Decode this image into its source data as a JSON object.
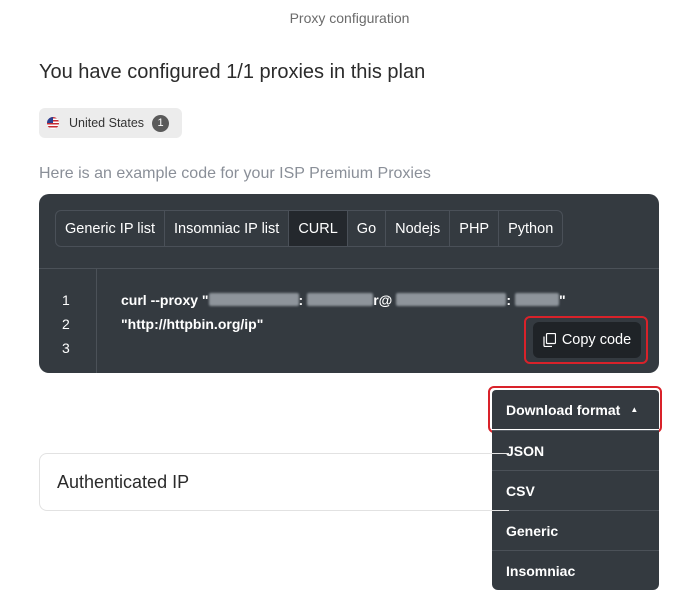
{
  "header": {
    "title": "Proxy configuration"
  },
  "plan": {
    "title": "You have configured 1/1 proxies in this plan",
    "country": {
      "label": "United States",
      "count": "1",
      "flag_icon": "us-flag-icon"
    }
  },
  "example": {
    "title": "Here is an example code for your ISP Premium Proxies",
    "tabs": [
      {
        "label": "Generic IP list",
        "active": false
      },
      {
        "label": "Insomniac IP list",
        "active": false
      },
      {
        "label": "CURL",
        "active": true
      },
      {
        "label": "Go",
        "active": false
      },
      {
        "label": "Nodejs",
        "active": false
      },
      {
        "label": "PHP",
        "active": false
      },
      {
        "label": "Python",
        "active": false
      }
    ],
    "line_numbers": [
      "1",
      "2",
      "3"
    ],
    "code": {
      "prefix": "curl --proxy \"",
      "sep1": ":",
      "at": "r@",
      "sep2": ":",
      "suffix": "\"",
      "line2": "\"http://httpbin.org/ip\""
    },
    "copy_button": {
      "label": "Copy code",
      "icon": "copy-icon"
    }
  },
  "download": {
    "label": "Download format",
    "caret": "▲",
    "options": [
      "JSON",
      "CSV",
      "Generic",
      "Insomniac"
    ]
  },
  "authenticated": {
    "title": "Authenticated IP"
  },
  "colors": {
    "panel": "#343a40",
    "highlight": "#d9222a",
    "active_tab": "#24282d"
  }
}
